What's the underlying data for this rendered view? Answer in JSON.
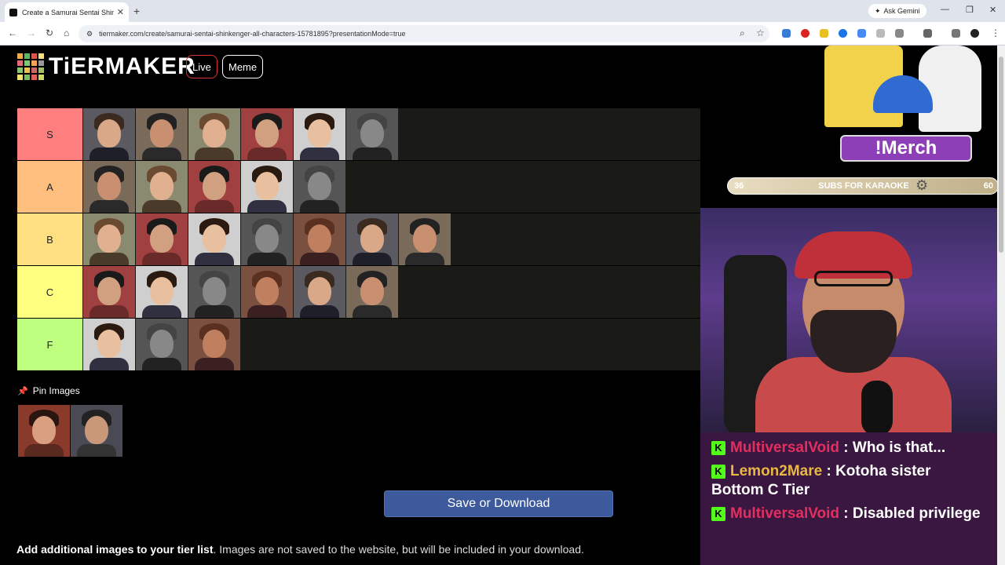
{
  "browser": {
    "tab_title": "Create a Samurai Sentai Shinke",
    "new_tab": "+",
    "gemini_label": "Ask Gemini",
    "url": "tiermaker.com/create/samurai-sentai-shinkenger-all-characters-15781895?presentationMode=true"
  },
  "header": {
    "logo": "TiERMAKER",
    "live_label": "Live",
    "meme_label": "Meme",
    "logo_colors": [
      "#f0ad4e",
      "#5cb85c",
      "#d9534f",
      "#f7e07c",
      "#e06c75",
      "#7ec86f",
      "#f5a35a",
      "#999999",
      "#88c46b",
      "#f0c24a",
      "#cc6666",
      "#a0c060",
      "#f1e36b",
      "#78c05a",
      "#e0605a",
      "#ccd860"
    ]
  },
  "tiers": [
    {
      "label": "S",
      "color": "#ff7f7f",
      "count": 6
    },
    {
      "label": "A",
      "color": "#ffbf7f",
      "count": 5
    },
    {
      "label": "B",
      "color": "#ffdf7f",
      "count": 7
    },
    {
      "label": "C",
      "color": "#ffff7f",
      "count": 6
    },
    {
      "label": "F",
      "color": "#bfff7f",
      "count": 3
    }
  ],
  "pin": {
    "label": "Pin Images",
    "icon": "pushpin-icon"
  },
  "save_button": "Save or Download",
  "add_images": {
    "bold": "Add additional images to your tier list",
    "rest": ". Images are not saved to the website, but will be included in your download."
  },
  "overlay": {
    "merch_label": "!Merch",
    "sub_start": "36",
    "sub_goal_text": "SUBS FOR KARAOKE",
    "sub_end": "60"
  },
  "chat": [
    {
      "user": "MultiversalVoid",
      "text": ": Who is that...",
      "color": "u1"
    },
    {
      "user": "Lemon2Mare",
      "text": ": Kotoha sister Bottom C Tier",
      "color": "u2"
    },
    {
      "user": "MultiversalVoid",
      "text": ": Disabled privilege",
      "color": "u1"
    }
  ]
}
